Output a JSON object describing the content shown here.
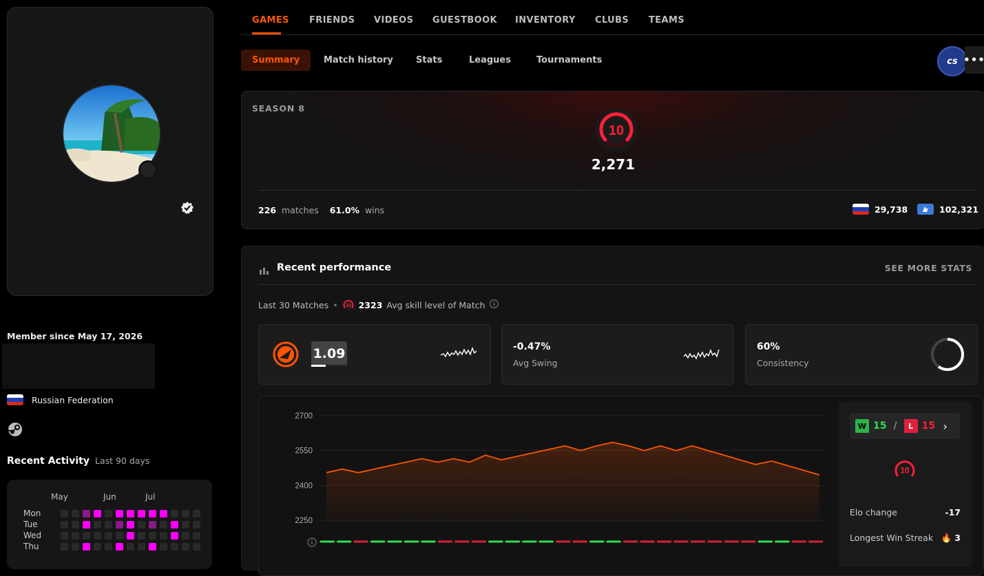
{
  "profile": {
    "member_since": "Member since May 17, 2026",
    "country": "Russian Federation"
  },
  "recent_activity": {
    "title": "Recent Activity",
    "period": "Last 90 days",
    "months": [
      "May",
      "Jun",
      "Jul"
    ],
    "days": [
      "Mon",
      "Tue",
      "Wed",
      "Thu"
    ],
    "grid": [
      [
        0,
        0,
        1,
        2,
        0,
        2,
        2,
        2,
        2,
        2,
        0,
        0,
        0
      ],
      [
        0,
        0,
        2,
        0,
        0,
        1,
        2,
        0,
        1,
        0,
        2,
        0,
        0
      ],
      [
        0,
        0,
        0,
        0,
        0,
        0,
        2,
        0,
        0,
        0,
        2,
        0,
        0
      ],
      [
        0,
        0,
        2,
        0,
        0,
        2,
        0,
        0,
        2,
        0,
        0,
        0,
        0
      ]
    ],
    "colors": {
      "empty": "#2a2a2a",
      "low": "#8a1a8a",
      "high": "#ff00ff"
    }
  },
  "topnav": {
    "items": [
      "GAMES",
      "FRIENDS",
      "VIDEOS",
      "GUESTBOOK",
      "INVENTORY",
      "CLUBS",
      "TEAMS"
    ],
    "active": "GAMES"
  },
  "subnav": {
    "items": [
      "Summary",
      "Match history",
      "Stats",
      "Leagues",
      "Tournaments"
    ],
    "active": "Summary"
  },
  "game_badge": "cs",
  "season": {
    "label": "SEASON 8",
    "level": "10",
    "elo": "2,271",
    "matches": "226",
    "matches_label": "matches",
    "winrate": "61.0%",
    "wins_label": "wins",
    "country_rank": "29,738",
    "region_rank": "102,321"
  },
  "performance": {
    "title": "Recent performance",
    "see_more": "SEE MORE STATS",
    "last_matches": "Last 30 Matches",
    "avg_level_icon": "10",
    "avg_skill_value": "2323",
    "avg_skill_label": "Avg skill level of Match",
    "rating": {
      "value": "1.09",
      "fill_fraction": 0.4
    },
    "swing": {
      "value": "-0.47%",
      "label": "Avg Swing"
    },
    "consistency": {
      "value": "60%",
      "label": "Consistency",
      "fraction": 0.6
    },
    "wl": {
      "w_badge": "W",
      "wins": "15",
      "sep": "/",
      "l_badge": "L",
      "losses": "15",
      "arrow": "›"
    },
    "side_level": "10",
    "elo_change": {
      "label": "Elo change",
      "value": "-17"
    },
    "longest_streak": {
      "label": "Longest Win Streak",
      "value": "3"
    }
  },
  "chart_data": {
    "type": "area",
    "ylim": [
      2250,
      2700
    ],
    "yticks": [
      "2700",
      "2550",
      "2400",
      "2250"
    ],
    "ytick_values": [
      2700,
      2550,
      2400,
      2250
    ],
    "series": [
      {
        "values": [
          2455,
          2470,
          2455,
          2470,
          2485,
          2500,
          2515,
          2500,
          2515,
          2500,
          2530,
          2510,
          2525,
          2540,
          2555,
          2570,
          2550,
          2570,
          2585,
          2570,
          2550,
          2570,
          2550,
          2570,
          2550,
          2530,
          2510,
          2490,
          2505,
          2485,
          2465,
          2445
        ],
        "color": "#ff5500"
      }
    ],
    "results": [
      "W",
      "W",
      "L",
      "W",
      "W",
      "W",
      "W",
      "L",
      "L",
      "L",
      "W",
      "W",
      "W",
      "W",
      "L",
      "L",
      "W",
      "W",
      "L",
      "L",
      "L",
      "L",
      "L",
      "L",
      "L",
      "L",
      "W",
      "W",
      "L",
      "L"
    ],
    "result_colors": {
      "W": "#2fe04a",
      "L": "#d8213a"
    }
  }
}
